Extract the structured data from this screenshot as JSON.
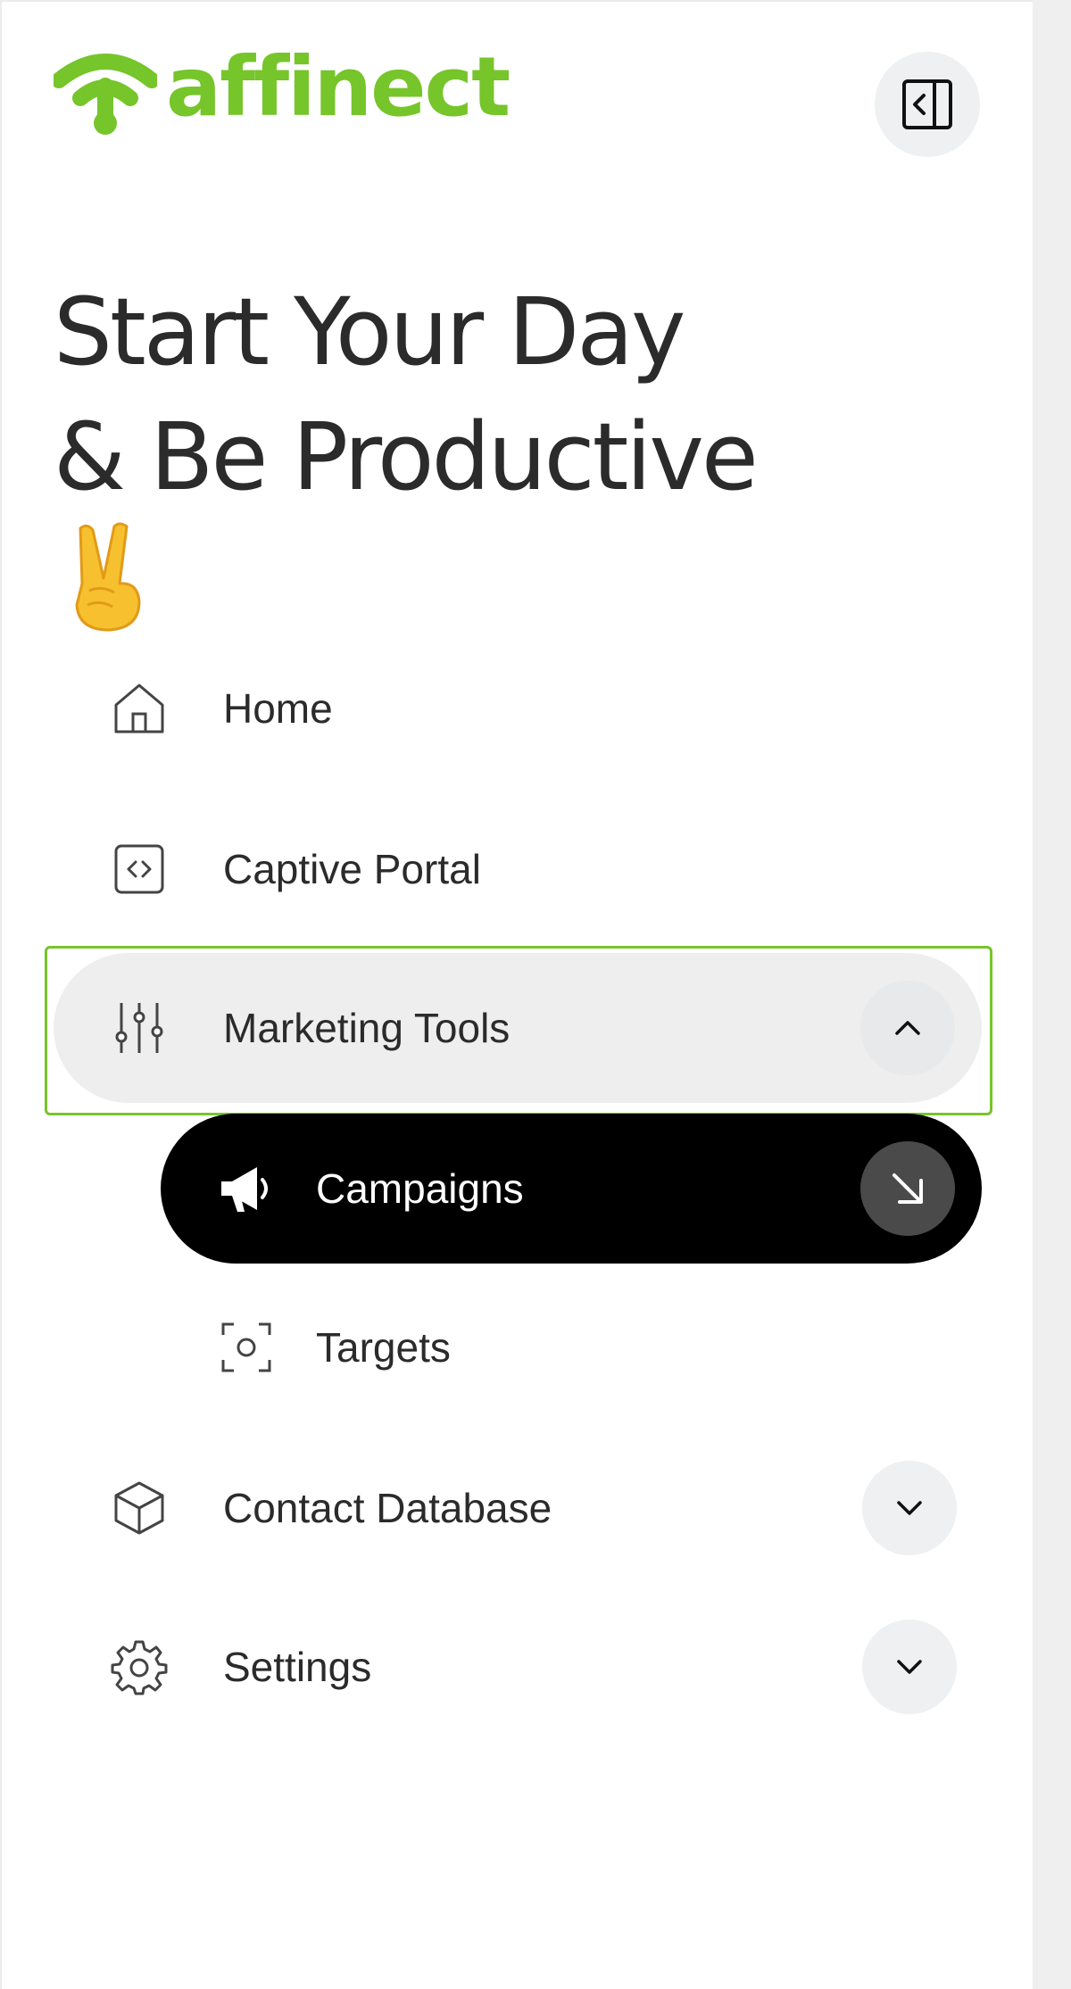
{
  "brand": {
    "name": "affinect",
    "color": "#76c52a"
  },
  "headline": {
    "line1": "Start Your Day",
    "line2": "& Be Productive"
  },
  "nav": {
    "home": {
      "label": "Home",
      "icon": "house-icon"
    },
    "captive_portal": {
      "label": "Captive Portal",
      "icon": "code-brackets-icon"
    },
    "marketing_tools": {
      "label": "Marketing Tools",
      "icon": "sliders-icon",
      "expanded": true
    },
    "campaigns": {
      "label": "Campaigns",
      "icon": "megaphone-icon",
      "active": true
    },
    "targets": {
      "label": "Targets",
      "icon": "target-focus-icon"
    },
    "contact_database": {
      "label": "Contact Database",
      "icon": "cube-icon",
      "expanded": false
    },
    "settings": {
      "label": "Settings",
      "icon": "gear-icon",
      "expanded": false
    }
  },
  "colors": {
    "active_bg": "#000000",
    "hover_bg": "#eeeeee",
    "focus_outline": "#76c52a",
    "text": "#2b2b2b"
  }
}
